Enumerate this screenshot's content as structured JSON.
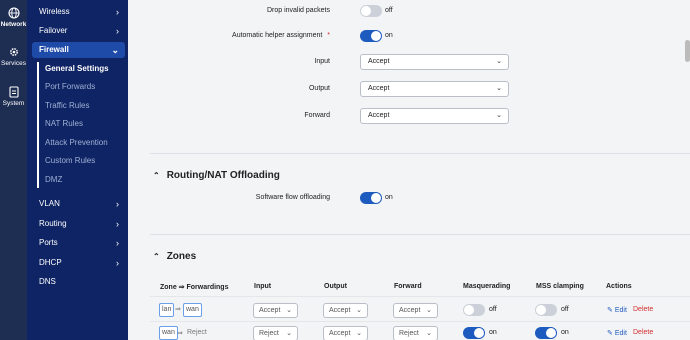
{
  "rail": [
    {
      "label": "Network",
      "icon": "globe-icon",
      "active": true
    },
    {
      "label": "Services",
      "icon": "gear-icon",
      "active": false
    },
    {
      "label": "System",
      "icon": "system-icon",
      "active": false
    }
  ],
  "nav": {
    "items_top": [
      {
        "label": "Wireless",
        "chev": "›"
      },
      {
        "label": "Failover",
        "chev": "›"
      },
      {
        "label": "Firewall",
        "chev": "⌄"
      }
    ],
    "sub_items": [
      "General Settings",
      "Port Forwards",
      "Traffic Rules",
      "NAT Rules",
      "Attack Prevention",
      "Custom Rules",
      "DMZ"
    ],
    "items_bottom": [
      {
        "label": "VLAN",
        "chev": "›"
      },
      {
        "label": "Routing",
        "chev": "›"
      },
      {
        "label": "Ports",
        "chev": "›"
      },
      {
        "label": "DHCP",
        "chev": "›"
      },
      {
        "label": "DNS",
        "chev": ""
      }
    ]
  },
  "general": {
    "drop_invalid": {
      "label": "Drop invalid packets",
      "state": "off"
    },
    "helper": {
      "label": "Automatic helper assignment",
      "marker": "*",
      "state": "on"
    },
    "input": {
      "label": "Input",
      "value": "Accept"
    },
    "output": {
      "label": "Output",
      "value": "Accept"
    },
    "forward": {
      "label": "Forward",
      "value": "Accept"
    }
  },
  "offloading": {
    "title": "Routing/NAT Offloading",
    "flow": {
      "label": "Software flow offloading",
      "state": "on"
    }
  },
  "zones": {
    "title": "Zones",
    "headers": [
      "Zone ⇒ Forwardings",
      "Input",
      "Output",
      "Forward",
      "Masquerading",
      "MSS clamping",
      "Actions"
    ],
    "rows": [
      {
        "zone": "lan",
        "arrow": "⇒",
        "target": "wan",
        "target_boxed": true,
        "input": "Accept",
        "output": "Accept",
        "forward": "Accept",
        "masq": "off",
        "mss": "off",
        "edit": "Edit",
        "delete": "Delete"
      },
      {
        "zone": "wan",
        "arrow": "⇒",
        "target": "Reject",
        "target_boxed": false,
        "input": "Reject",
        "output": "Accept",
        "forward": "Reject",
        "masq": "on",
        "mss": "on",
        "edit": "Edit",
        "delete": "Delete"
      }
    ]
  },
  "colors": {
    "accent": "#1d5bbf",
    "nav_bg": "#0f2464",
    "rail_bg": "#1e2d52",
    "delete": "#d32f2f"
  }
}
